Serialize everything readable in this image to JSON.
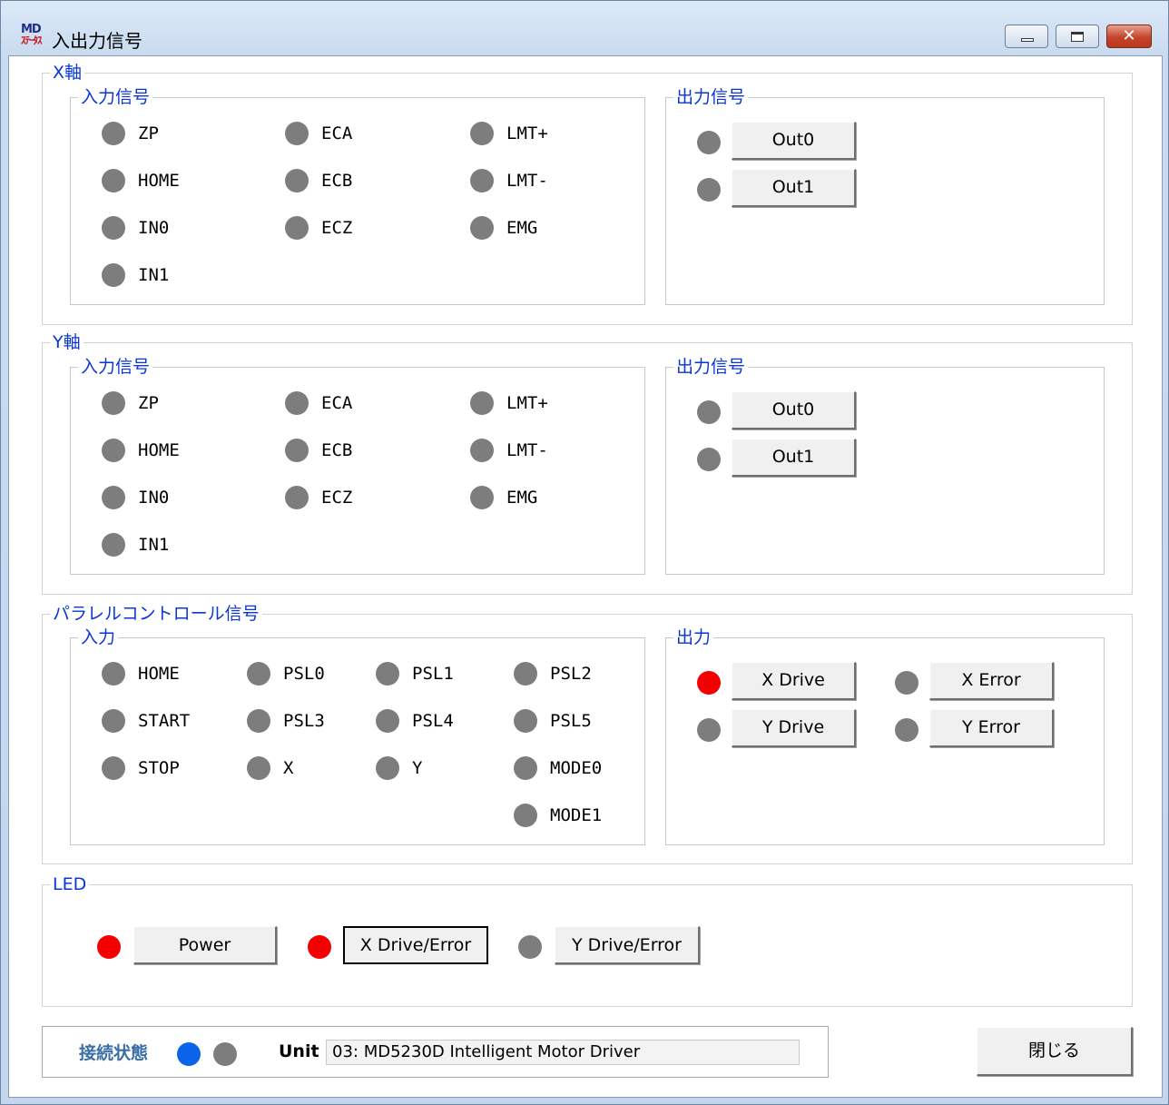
{
  "window": {
    "title": "入出力信号",
    "icon_text_top": "MD",
    "icon_text_bottom": "ｽﾃｰﾀｽ"
  },
  "x_axis": {
    "title": "X軸",
    "input": {
      "title": "入力信号",
      "signals": [
        "ZP",
        "ECA",
        "LMT+",
        "HOME",
        "ECB",
        "LMT-",
        "IN0",
        "ECZ",
        "EMG",
        "IN1"
      ]
    },
    "output": {
      "title": "出力信号",
      "buttons": [
        "Out0",
        "Out1"
      ]
    }
  },
  "y_axis": {
    "title": "Y軸",
    "input": {
      "title": "入力信号",
      "signals": [
        "ZP",
        "ECA",
        "LMT+",
        "HOME",
        "ECB",
        "LMT-",
        "IN0",
        "ECZ",
        "EMG",
        "IN1"
      ]
    },
    "output": {
      "title": "出力信号",
      "buttons": [
        "Out0",
        "Out1"
      ]
    }
  },
  "parallel": {
    "title": "パラレルコントロール信号",
    "input": {
      "title": "入力",
      "signals": [
        "HOME",
        "PSL0",
        "PSL1",
        "PSL2",
        "START",
        "PSL3",
        "PSL4",
        "PSL5",
        "STOP",
        "X",
        "Y",
        "MODE0",
        "MODE1"
      ]
    },
    "output": {
      "title": "出力",
      "buttons": [
        "X Drive",
        "X Error",
        "Y Drive",
        "Y Error"
      ],
      "states": [
        "on",
        "off",
        "off",
        "off"
      ]
    }
  },
  "led": {
    "title": "LED",
    "buttons": [
      "Power",
      "X Drive/Error",
      "Y Drive/Error"
    ],
    "states": [
      "on",
      "on",
      "off"
    ]
  },
  "status": {
    "connection_label": "接続状態",
    "unit_label": "Unit",
    "unit_value": "03: MD5230D Intelligent Motor Driver"
  },
  "close_button": "閉じる",
  "colors": {
    "led_off": "#7d7d7d",
    "led_on_red": "#f50000",
    "led_connected_blue": "#0b63ea",
    "legend_blue": "#0a36d8"
  }
}
